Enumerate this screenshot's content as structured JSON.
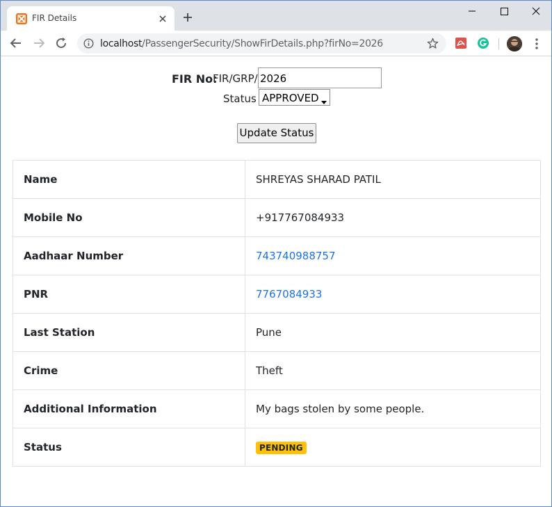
{
  "browser": {
    "tab_title": "FIR Details",
    "url_host": "localhost",
    "url_path": "/PassengerSecurity/ShowFirDetails.php?firNo=2026",
    "icons": [
      "favicon-icon",
      "close-icon",
      "new-tab-icon",
      "minimize-icon",
      "maximize-icon",
      "window-close-icon",
      "back-icon",
      "forward-icon",
      "reload-icon",
      "info-icon",
      "star-icon",
      "pdf-extension-icon",
      "grammarly-icon",
      "avatar",
      "menu-icon"
    ]
  },
  "form": {
    "fir_label": "FIR No:",
    "fir_prefix": "FIR/GRP/",
    "fir_value": "2026",
    "status_label": "Status :",
    "status_selected": "APPROVED",
    "update_button": "Update Status"
  },
  "details": [
    {
      "key": "Name",
      "value": "SHREYAS SHARAD PATIL"
    },
    {
      "key": "Mobile No",
      "value": "+917767084933"
    },
    {
      "key": "Aadhaar Number",
      "value": "743740988757"
    },
    {
      "key": "PNR",
      "value": "7767084933"
    },
    {
      "key": "Last Station",
      "value": "Pune"
    },
    {
      "key": "Crime",
      "value": "Theft"
    },
    {
      "key": "Additional Information",
      "value": "My bags stolen by some people."
    },
    {
      "key": "Status",
      "value": "PENDING"
    }
  ],
  "colors": {
    "link": "#1a73e8",
    "badge_warning": "#ffc107",
    "favicon": "#e8711c"
  }
}
